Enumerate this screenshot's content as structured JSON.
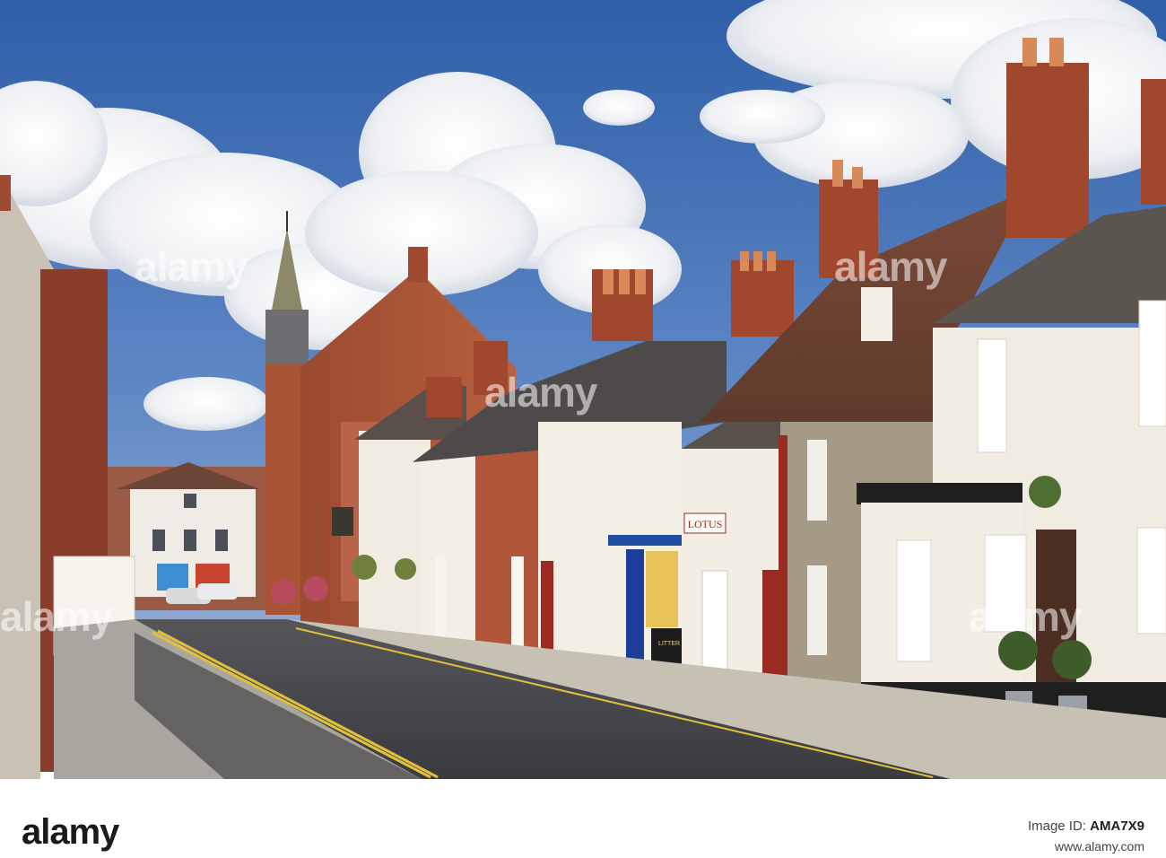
{
  "watermark": {
    "brand": "alamy",
    "center_text": "alamy"
  },
  "signs": {
    "shop_sign": "LOTUS",
    "bin_label": "LITTER"
  },
  "footer": {
    "logo": "alamy",
    "image_id_label": "Image ID:",
    "image_id": "AMA7X9",
    "site": "www.alamy.com"
  }
}
